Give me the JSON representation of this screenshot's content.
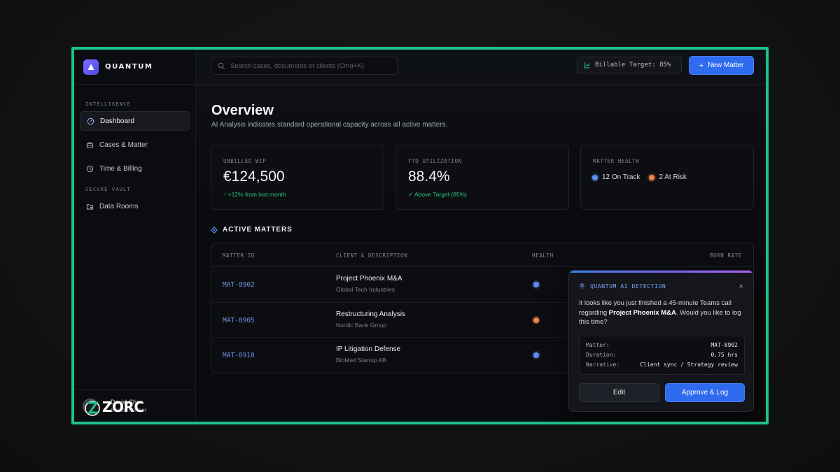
{
  "app": {
    "name": "QUANTUM"
  },
  "sidebar": {
    "sections": [
      "INTELLIGENCE",
      "SECURE VAULT"
    ],
    "items": [
      {
        "label": "Dashboard",
        "icon": "gauge-icon",
        "active": true
      },
      {
        "label": "Cases & Matter",
        "icon": "briefcase-icon"
      },
      {
        "label": "Time & Billing",
        "icon": "clock-icon"
      },
      {
        "label": "Data Rooms",
        "icon": "folder-lock-icon"
      }
    ],
    "user": {
      "name": "David Cher",
      "role": "Senior Partner"
    },
    "watermark": "ZORC"
  },
  "topbar": {
    "search_placeholder": "Search cases, documents or clients (Cmd+K)",
    "billable_target": "Billable Target: 85%",
    "new_matter_label": "New Matter"
  },
  "overview": {
    "title": "Overview",
    "subtitle": "AI Analysis indicates standard operational capacity across all active matters."
  },
  "cards": {
    "wip": {
      "label": "UNBILLED WIP",
      "value": "€124,500",
      "sub": "↑ +12% from last month"
    },
    "util": {
      "label": "YTD UTILIZATION",
      "value": "88.4%",
      "sub": "✓ Above Target (85%)"
    },
    "health": {
      "label": "MATTER HEALTH",
      "on_track": "12 On Track",
      "at_risk": "2 At Risk"
    }
  },
  "matters": {
    "heading": "ACTIVE MATTERS",
    "columns": [
      "MATTER ID",
      "CLIENT & DESCRIPTION",
      "HEALTH",
      "BURN RATE"
    ],
    "rows": [
      {
        "id": "MAT-8902",
        "client": "Project Phoenix M&A",
        "desc": "Global Tech Industries",
        "health": "on-track"
      },
      {
        "id": "MAT-8905",
        "client": "Restructuring Analysis",
        "desc": "Nordic Bank Group",
        "health": "at-risk"
      },
      {
        "id": "MAT-8910",
        "client": "IP Litigation Defense",
        "desc": "BioMed Startup AB",
        "health": "on-track"
      }
    ]
  },
  "ai_popup": {
    "title": "QUANTUM AI DETECTION",
    "close": "×",
    "message_pre": "It looks like you just finished a 45-minute Teams call regarding ",
    "message_bold": "Project Phoenix M&A",
    "message_post": ". Would you like to log this time?",
    "details": [
      {
        "key": "Matter:",
        "value": "MAT-8902"
      },
      {
        "key": "Duration:",
        "value": "0.75 hrs"
      },
      {
        "key": "Narrative:",
        "value": "Client sync / Strategy review"
      }
    ],
    "edit_label": "Edit",
    "approve_label": "Approve & Log"
  },
  "colors": {
    "frame": "#1ec28b",
    "accent": "#2f6bef",
    "on_track": "#5b8ff5",
    "at_risk": "#f08552",
    "positive": "#27c381"
  }
}
